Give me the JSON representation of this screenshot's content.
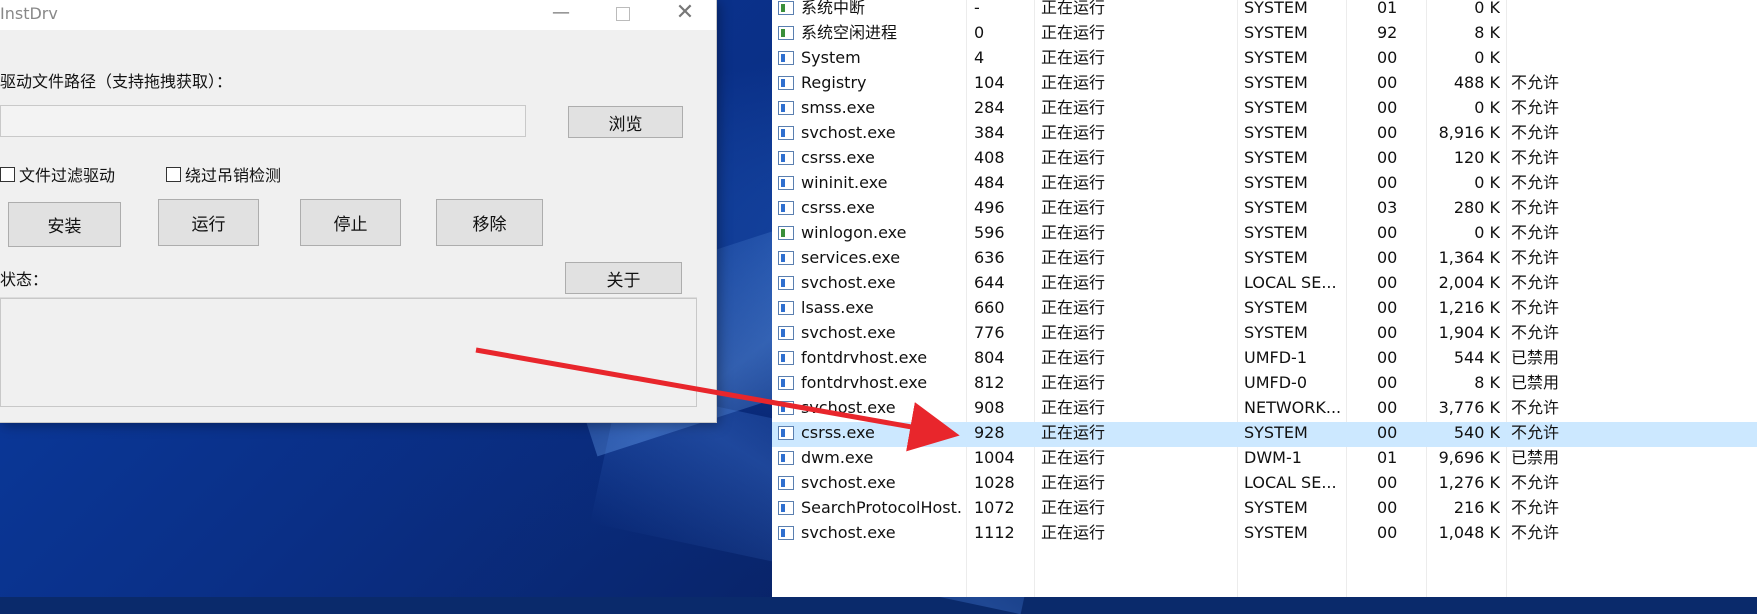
{
  "window": {
    "title": "InstDrv",
    "path_label": "驱动文件路径（支持拖拽获取）：",
    "path_value": "",
    "browse_button": "浏览",
    "filter_driver_label": "文件过滤驱动",
    "bypass_revocation_label": "绕过吊销检测",
    "install_button": "安装",
    "run_button": "运行",
    "stop_button": "停止",
    "remove_button": "移除",
    "status_label": "状态：",
    "about_button": "关于"
  },
  "colors": {
    "selection": "#cce8ff",
    "arrow": "#e8262c",
    "window_bg": "#f0f0f0"
  },
  "processes": [
    {
      "name": "系统中断",
      "pid": "-",
      "status": "正在运行",
      "user": "SYSTEM",
      "cpu": "01",
      "mem": "0 K",
      "uac": "",
      "icon": "system-process-icon"
    },
    {
      "name": "系统空闲进程",
      "pid": "0",
      "status": "正在运行",
      "user": "SYSTEM",
      "cpu": "92",
      "mem": "8 K",
      "uac": "",
      "icon": "system-process-icon"
    },
    {
      "name": "System",
      "pid": "4",
      "status": "正在运行",
      "user": "SYSTEM",
      "cpu": "00",
      "mem": "0 K",
      "uac": "",
      "icon": "process-icon"
    },
    {
      "name": "Registry",
      "pid": "104",
      "status": "正在运行",
      "user": "SYSTEM",
      "cpu": "00",
      "mem": "488 K",
      "uac": "不允许",
      "icon": "process-icon"
    },
    {
      "name": "smss.exe",
      "pid": "284",
      "status": "正在运行",
      "user": "SYSTEM",
      "cpu": "00",
      "mem": "0 K",
      "uac": "不允许",
      "icon": "process-icon"
    },
    {
      "name": "svchost.exe",
      "pid": "384",
      "status": "正在运行",
      "user": "SYSTEM",
      "cpu": "00",
      "mem": "8,916 K",
      "uac": "不允许",
      "icon": "process-icon"
    },
    {
      "name": "csrss.exe",
      "pid": "408",
      "status": "正在运行",
      "user": "SYSTEM",
      "cpu": "00",
      "mem": "120 K",
      "uac": "不允许",
      "icon": "process-icon"
    },
    {
      "name": "wininit.exe",
      "pid": "484",
      "status": "正在运行",
      "user": "SYSTEM",
      "cpu": "00",
      "mem": "0 K",
      "uac": "不允许",
      "icon": "process-icon"
    },
    {
      "name": "csrss.exe",
      "pid": "496",
      "status": "正在运行",
      "user": "SYSTEM",
      "cpu": "03",
      "mem": "280 K",
      "uac": "不允许",
      "icon": "process-icon"
    },
    {
      "name": "winlogon.exe",
      "pid": "596",
      "status": "正在运行",
      "user": "SYSTEM",
      "cpu": "00",
      "mem": "0 K",
      "uac": "不允许",
      "icon": "system-process-icon"
    },
    {
      "name": "services.exe",
      "pid": "636",
      "status": "正在运行",
      "user": "SYSTEM",
      "cpu": "00",
      "mem": "1,364 K",
      "uac": "不允许",
      "icon": "process-icon"
    },
    {
      "name": "svchost.exe",
      "pid": "644",
      "status": "正在运行",
      "user": "LOCAL SE...",
      "cpu": "00",
      "mem": "2,004 K",
      "uac": "不允许",
      "icon": "process-icon"
    },
    {
      "name": "lsass.exe",
      "pid": "660",
      "status": "正在运行",
      "user": "SYSTEM",
      "cpu": "00",
      "mem": "1,216 K",
      "uac": "不允许",
      "icon": "process-icon"
    },
    {
      "name": "svchost.exe",
      "pid": "776",
      "status": "正在运行",
      "user": "SYSTEM",
      "cpu": "00",
      "mem": "1,904 K",
      "uac": "不允许",
      "icon": "process-icon"
    },
    {
      "name": "fontdrvhost.exe",
      "pid": "804",
      "status": "正在运行",
      "user": "UMFD-1",
      "cpu": "00",
      "mem": "544 K",
      "uac": "已禁用",
      "icon": "process-icon"
    },
    {
      "name": "fontdrvhost.exe",
      "pid": "812",
      "status": "正在运行",
      "user": "UMFD-0",
      "cpu": "00",
      "mem": "8 K",
      "uac": "已禁用",
      "icon": "process-icon"
    },
    {
      "name": "svchost.exe",
      "pid": "908",
      "status": "正在运行",
      "user": "NETWORK...",
      "cpu": "00",
      "mem": "3,776 K",
      "uac": "不允许",
      "icon": "process-icon"
    },
    {
      "name": "csrss.exe",
      "pid": "928",
      "status": "正在运行",
      "user": "SYSTEM",
      "cpu": "00",
      "mem": "540 K",
      "uac": "不允许",
      "icon": "process-icon",
      "selected": true
    },
    {
      "name": "dwm.exe",
      "pid": "1004",
      "status": "正在运行",
      "user": "DWM-1",
      "cpu": "01",
      "mem": "9,696 K",
      "uac": "已禁用",
      "icon": "process-icon"
    },
    {
      "name": "svchost.exe",
      "pid": "1028",
      "status": "正在运行",
      "user": "LOCAL SE...",
      "cpu": "00",
      "mem": "1,276 K",
      "uac": "不允许",
      "icon": "process-icon"
    },
    {
      "name": "SearchProtocolHost...",
      "pid": "1072",
      "status": "正在运行",
      "user": "SYSTEM",
      "cpu": "00",
      "mem": "216 K",
      "uac": "不允许",
      "icon": "search-process-icon"
    },
    {
      "name": "svchost.exe",
      "pid": "1112",
      "status": "正在运行",
      "user": "SYSTEM",
      "cpu": "00",
      "mem": "1,048 K",
      "uac": "不允许",
      "icon": "process-icon"
    }
  ]
}
